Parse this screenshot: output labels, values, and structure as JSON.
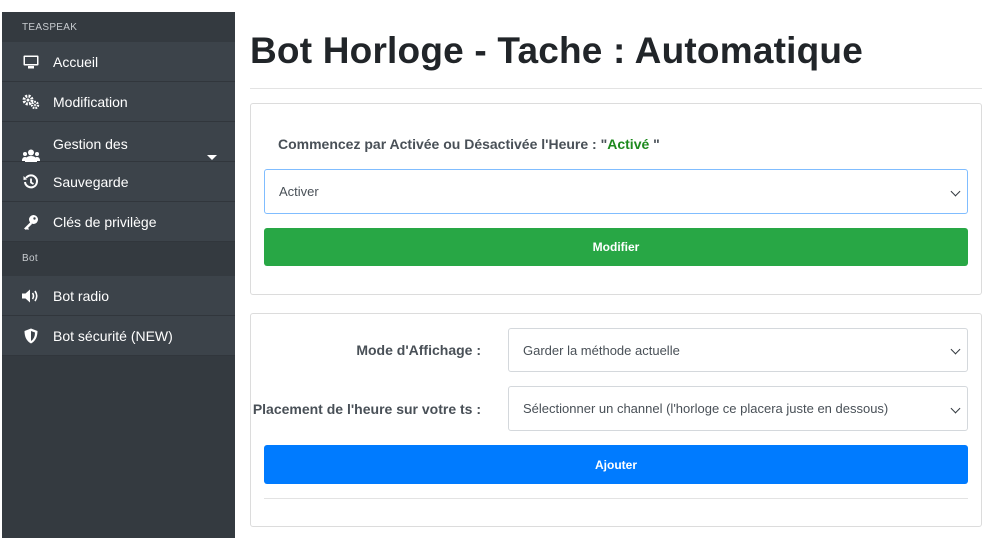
{
  "sidebar": {
    "section_teaspeak": "TEASPEAK",
    "section_bot": "Bot",
    "items": [
      {
        "label": "Accueil",
        "icon": "desktop-icon"
      },
      {
        "label": "Modification",
        "icon": "gears-icon"
      },
      {
        "label": "Gestion des",
        "icon": "users-icon"
      },
      {
        "label": "Sauvegarde",
        "icon": "history-icon"
      },
      {
        "label": "Clés de privilège",
        "icon": "key-icon"
      }
    ],
    "bot_items": [
      {
        "label": "Bot radio",
        "icon": "volume-icon"
      },
      {
        "label": "Bot sécurité (NEW)",
        "icon": "shield-icon"
      }
    ]
  },
  "main": {
    "title": "Bot Horloge - Tache : Automatique",
    "status": {
      "prefix": "Commencez par Activée ou Désactivée l'Heure : \"",
      "value": "Activé",
      "suffix": " \"",
      "value_color": "#1e8a1e"
    },
    "toggle_select": {
      "selected": "Activer"
    },
    "modify_button": "Modifier",
    "display_mode": {
      "label": "Mode d'Affichage :",
      "selected": "Garder la méthode actuelle"
    },
    "placement": {
      "label": "Placement de l'heure sur votre ts :",
      "selected": "Sélectionner un channel (l'horloge ce placera juste en dessous)"
    },
    "add_button": "Ajouter"
  },
  "colors": {
    "sidebar_bg": "#343a40",
    "green": "#28a745",
    "blue": "#007bff"
  }
}
